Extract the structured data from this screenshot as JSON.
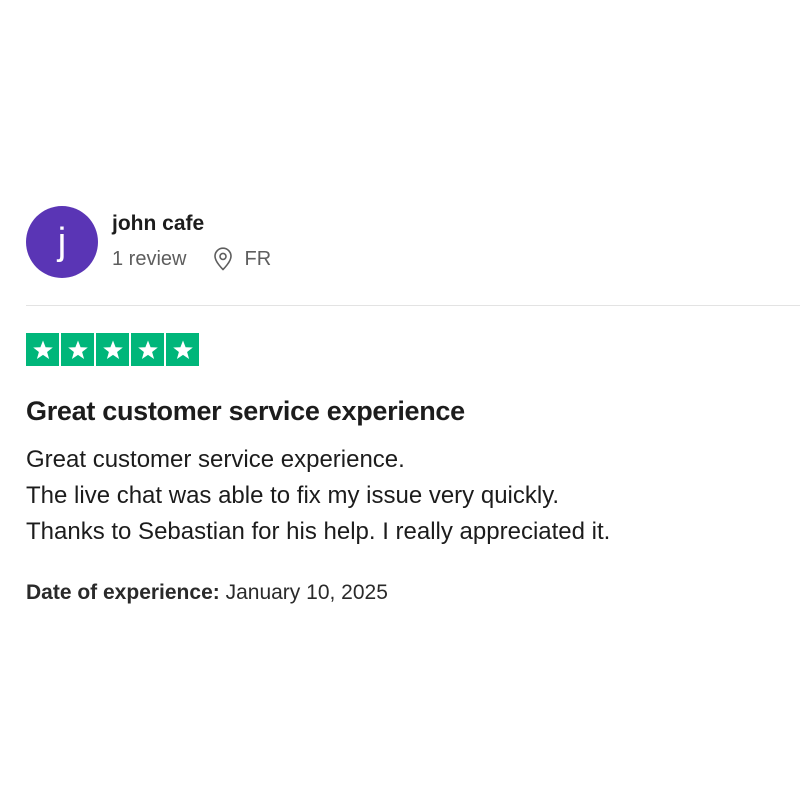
{
  "reviewer": {
    "avatar_initial": "j",
    "avatar_color": "#5a35b5",
    "name": "john cafe",
    "review_count": "1 review",
    "location_icon": "location-pin-icon",
    "country": "FR"
  },
  "review": {
    "rating": 5,
    "rating_max": 5,
    "star_color": "#00b67a",
    "star_icon": "star-icon",
    "title": "Great customer service experience",
    "body_lines": [
      "Great customer service experience.",
      "The live chat was able to fix my issue very quickly.",
      "Thanks to Sebastian for his help. I really appreciated it."
    ],
    "date_label": "Date of experience:",
    "date_value": "January 10, 2025"
  }
}
